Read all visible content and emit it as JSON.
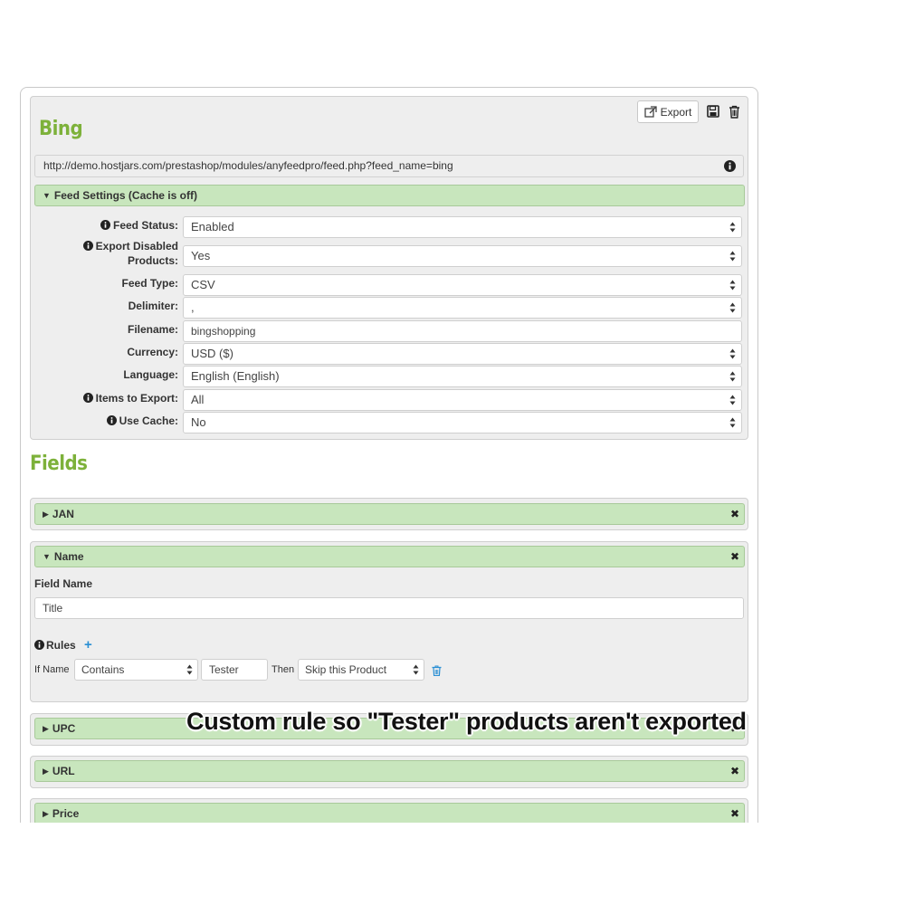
{
  "feed": {
    "title": "Bing",
    "export_label": "Export",
    "url": "http://demo.hostjars.com/prestashop/modules/anyfeedpro/feed.php?feed_name=bing",
    "settings_header": "Feed Settings (Cache is off)",
    "settings": [
      {
        "label": "Feed Status:",
        "value": "Enabled"
      },
      {
        "label_line1": "Export Disabled",
        "label_line2": "Products:",
        "value": "Yes"
      },
      {
        "label": "Feed Type:",
        "value": "CSV"
      },
      {
        "label": "Delimiter:",
        "value": ","
      },
      {
        "label": "Filename:",
        "value": "bingshopping"
      },
      {
        "label": "Currency:",
        "value": "USD ($)"
      },
      {
        "label": "Language:",
        "value": "English (English)"
      },
      {
        "label": "Items to Export:",
        "value": "All"
      },
      {
        "label": "Use Cache:",
        "value": "No"
      }
    ]
  },
  "fields": {
    "title": "Fields",
    "items": [
      {
        "label": "JAN"
      },
      {
        "label": "Name"
      },
      {
        "label": "UPC"
      },
      {
        "label": "URL"
      },
      {
        "label": "Price"
      }
    ],
    "name_panel": {
      "field_name_label": "Field Name",
      "field_name_value": "Title",
      "rules_label": "Rules",
      "rule": {
        "if_label": "If Name",
        "condition": "Contains",
        "value": "Tester",
        "then_label": "Then",
        "action": "Skip this Product"
      }
    }
  },
  "caption": "Custom rule so \"Tester\" products aren't exported",
  "colors": {
    "accent_green": "#7db13a",
    "bar_green": "#c8e6bd",
    "plus_blue": "#2a8fd4"
  }
}
